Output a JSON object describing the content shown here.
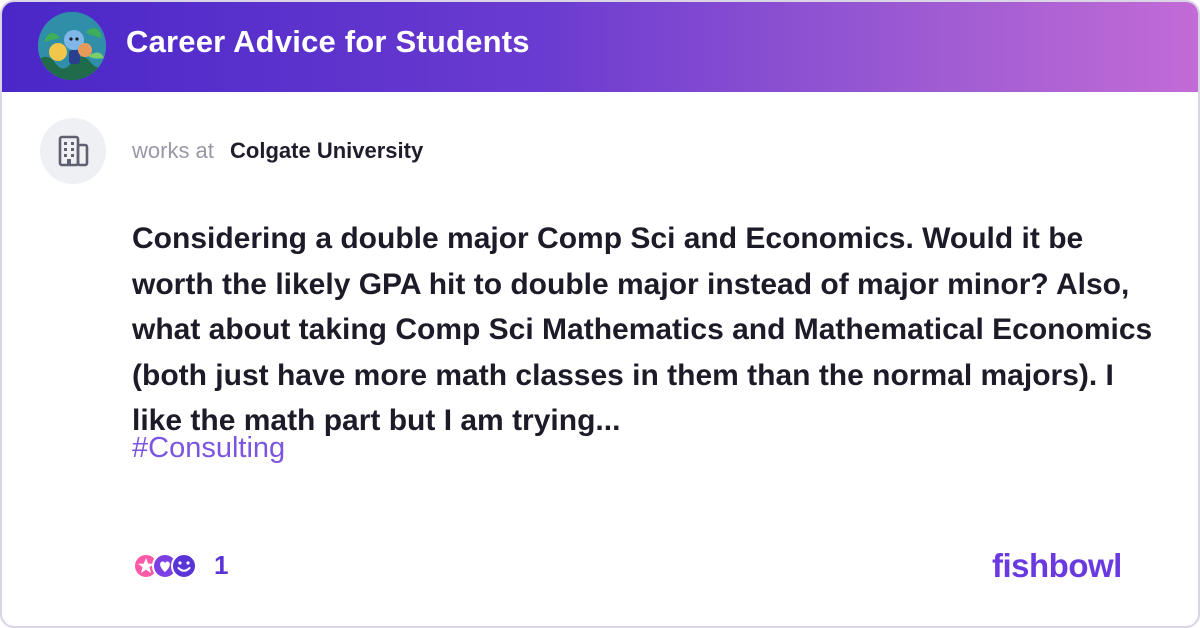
{
  "header": {
    "bowl_name": "Career Advice for Students",
    "avatar_icon": "bowl-illustration-icon"
  },
  "author": {
    "icon": "building-icon",
    "works_at_label": "works at",
    "company": "Colgate University"
  },
  "post": {
    "text": "Considering a double major Comp Sci and Economics. Would it be worth the likely GPA hit to double major instead of major minor? Also, what about taking Comp Sci Mathematics and Mathematical Economics (both just have more math classes in them than the normal majors). I like the math part but I am trying...",
    "hashtag": "#Consulting"
  },
  "footer": {
    "reaction_icons": [
      "star-icon",
      "heart-icon",
      "smile-icon"
    ],
    "reaction_count": "1",
    "brand_logo": "fishbowl"
  },
  "colors": {
    "header_gradient_start": "#4a27c8",
    "header_gradient_end": "#c26bd6",
    "hashtag": "#7b55e0",
    "brand": "#6a3ae0"
  }
}
